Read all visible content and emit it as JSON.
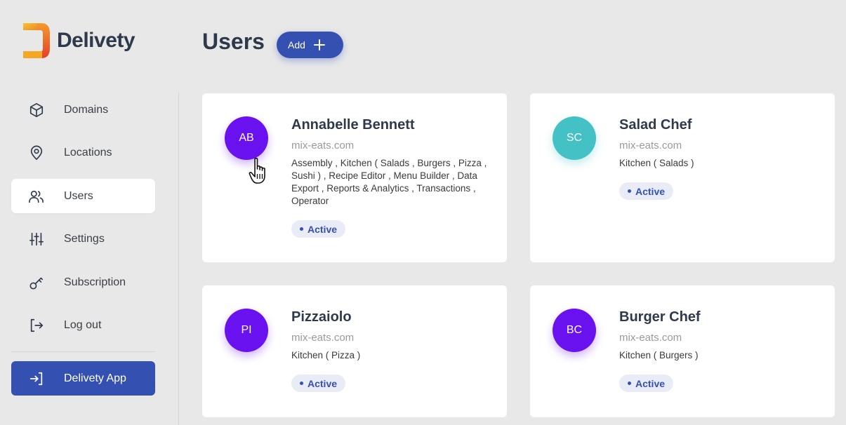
{
  "brand": {
    "name": "Delivety"
  },
  "sidebar": {
    "items": [
      {
        "label": "Domains",
        "icon": "box-icon"
      },
      {
        "label": "Locations",
        "icon": "map-pin-icon"
      },
      {
        "label": "Users",
        "icon": "users-icon",
        "active": true
      },
      {
        "label": "Settings",
        "icon": "sliders-icon"
      },
      {
        "label": "Subscription",
        "icon": "key-icon"
      },
      {
        "label": "Log out",
        "icon": "logout-icon"
      }
    ],
    "app_button": {
      "label": "Delivety App",
      "icon": "login-arrow-icon"
    }
  },
  "header": {
    "title": "Users",
    "add_label": "Add"
  },
  "users": [
    {
      "initials": "AB",
      "name": "Annabelle Bennett",
      "domain": "mix-eats.com",
      "roles": "Assembly , Kitchen ( Salads , Burgers , Pizza , Sushi ) , Recipe Editor , Menu Builder , Data Export , Reports & Analytics , Transactions , Operator",
      "status": "Active",
      "avatar_color": "#6a11f0"
    },
    {
      "initials": "SC",
      "name": "Salad Chef",
      "domain": "mix-eats.com",
      "roles": "Kitchen ( Salads )",
      "status": "Active",
      "avatar_color": "#44c1c4"
    },
    {
      "initials": "PI",
      "name": "Pizzaiolo",
      "domain": "mix-eats.com",
      "roles": "Kitchen ( Pizza )",
      "status": "Active",
      "avatar_color": "#6a11f0"
    },
    {
      "initials": "BC",
      "name": "Burger Chef",
      "domain": "mix-eats.com",
      "roles": "Kitchen ( Burgers )",
      "status": "Active",
      "avatar_color": "#6a11f0"
    }
  ],
  "colors": {
    "accent": "#3451b2",
    "background": "#e8e8e8",
    "card": "#ffffff",
    "badge_bg": "#e9ecf6"
  }
}
